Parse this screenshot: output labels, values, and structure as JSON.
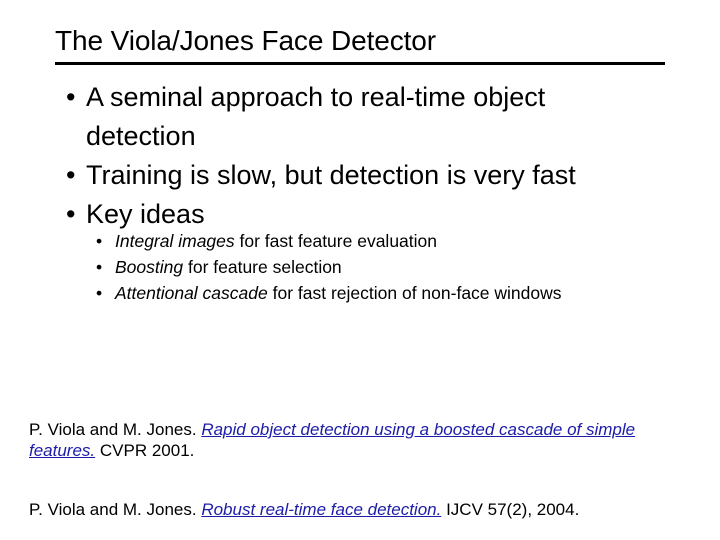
{
  "slide": {
    "title": "The Viola/Jones Face Detector",
    "bullet_char": "•",
    "link_color": "#1c1ca8",
    "text_color": "#000000",
    "background_color": "#ffffff"
  },
  "bullets": [
    {
      "text": "A seminal approach to real-time object detection"
    },
    {
      "text": "Training is slow, but detection is very fast"
    },
    {
      "text": "Key ideas"
    }
  ],
  "subbullets": [
    {
      "emphasis": "Integral images",
      "rest": " for fast feature evaluation"
    },
    {
      "emphasis": "Boosting",
      "rest": " for feature selection"
    },
    {
      "emphasis": "Attentional cascade",
      "rest": " for fast rejection of non-face windows"
    }
  ],
  "references": [
    {
      "authors": "P. Viola and M. Jones. ",
      "link": "Rapid object detection using a boosted cascade of simple features.",
      "venue": " CVPR 2001."
    },
    {
      "authors": "P. Viola and M. Jones. ",
      "link": "Robust real-time face detection.",
      "venue": " IJCV 57(2), 2004."
    }
  ]
}
